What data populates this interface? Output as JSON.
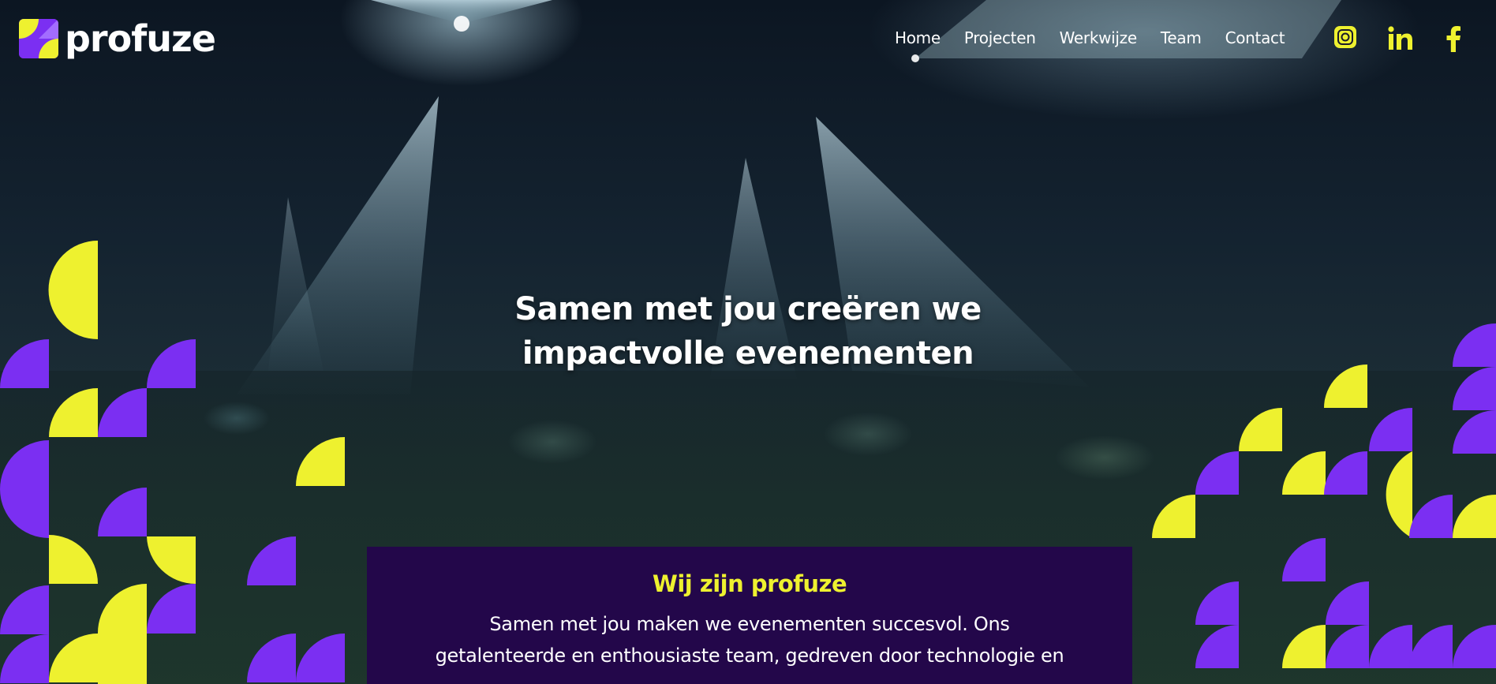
{
  "brand": {
    "name": "profuze"
  },
  "nav": {
    "items": [
      {
        "label": "Home"
      },
      {
        "label": "Projecten"
      },
      {
        "label": "Werkwijze"
      },
      {
        "label": "Team"
      },
      {
        "label": "Contact"
      }
    ]
  },
  "social": {
    "icons": [
      "instagram-icon",
      "linkedin-icon",
      "facebook-icon"
    ],
    "color": "#eef12f"
  },
  "hero": {
    "title_line1": "Samen met jou creëren we",
    "title_line2": "impactvolle evenementen"
  },
  "intro": {
    "heading": "Wij zijn profuze",
    "body_line1": "Samen met jou maken we evenementen succesvol. Ons",
    "body_line2": "getalenteerde en enthousiaste team, gedreven door technologie en"
  },
  "colors": {
    "accent_yellow": "#eef12f",
    "accent_purple": "#7b2ff2",
    "panel_bg": "#23074a"
  }
}
